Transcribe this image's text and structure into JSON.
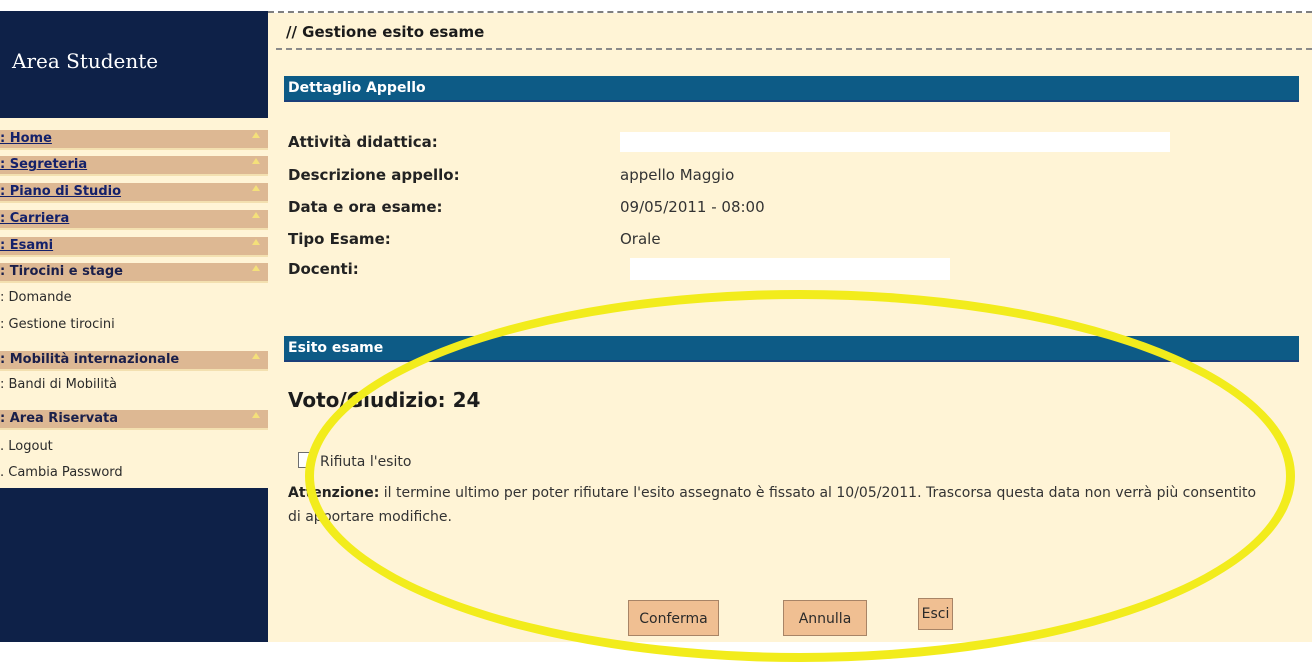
{
  "sidebar": {
    "title": "Area Studente",
    "items": [
      {
        "label": ": Home",
        "link": true
      },
      {
        "label": ": Segreteria",
        "link": true
      },
      {
        "label": ": Piano di Studio",
        "link": true
      },
      {
        "label": ": Carriera",
        "link": true
      },
      {
        "label": ": Esami",
        "link": true
      },
      {
        "label": ": Tirocini e stage",
        "link": false
      },
      {
        "label": ": Mobilità internazionale",
        "link": false
      },
      {
        "label": ": Area Riservata",
        "link": false
      }
    ],
    "subitems": {
      "tirocini": [
        ": Domande",
        ": Gestione tirocini"
      ],
      "mobilita": [
        ": Bandi di Mobilità"
      ],
      "riservata": [
        ". Logout",
        ". Cambia Password"
      ]
    }
  },
  "header": {
    "breadcrumb": "// Gestione esito esame"
  },
  "dettaglio": {
    "section_title": "Dettaglio Appello",
    "attivita_label": "Attività didattica:",
    "descrizione_label": "Descrizione appello:",
    "descrizione_value": "appello Maggio",
    "data_label": "Data e ora esame:",
    "data_value": "09/05/2011 - 08:00",
    "tipo_label": "Tipo Esame:",
    "tipo_value": "Orale",
    "docenti_label": "Docenti:"
  },
  "esito": {
    "section_title": "Esito esame",
    "grade": "Voto/Giudizio: 24",
    "reject_label": "Rifiuta l'esito",
    "reject_checked": false,
    "warning_bold": "Attenzione:",
    "warning_text": " il termine ultimo per poter rifiutare l'esito assegnato è fissato al 10/05/2011. Trascorsa questa data non verrà più consentito di apportare modifiche."
  },
  "buttons": {
    "confirm": "Conferma",
    "cancel": "Annulla",
    "exit": "Esci"
  },
  "colors": {
    "sidebar_bg": "#0e2148",
    "menu_item_bg": "#ddb893",
    "content_bg": "#fff4d6",
    "section_bar": "#0d5b86",
    "button_bg": "#f0bf92",
    "highlight": "#f2ec1c"
  }
}
